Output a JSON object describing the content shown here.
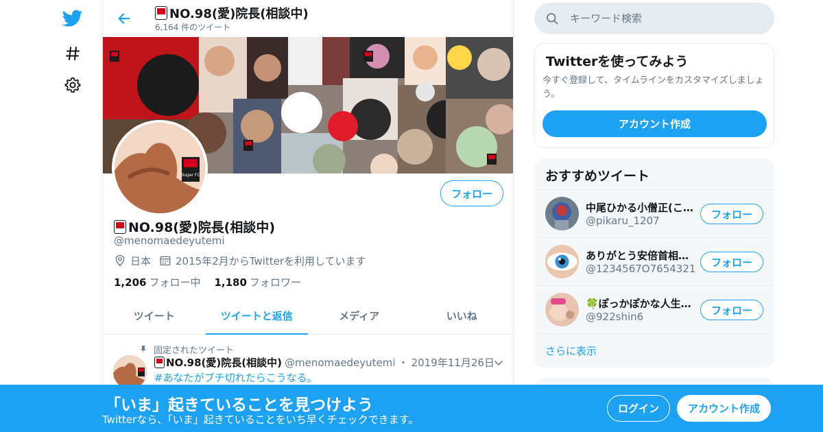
{
  "nav": {
    "items": [
      {
        "icon": "twitter-bird-icon"
      },
      {
        "icon": "hashtag-icon"
      },
      {
        "icon": "gear-icon"
      }
    ]
  },
  "header": {
    "name": "NO.98(愛)院長(相談中)",
    "tweet_count": "6,164 件のツイート"
  },
  "profile": {
    "name": "NO.98(愛)院長(相談中)",
    "handle": "@menomaedeyutemi",
    "location": "日本",
    "joined": "2015年2月からTwitterを利用しています",
    "following_count": "1,206",
    "following_label": "フォロー中",
    "followers_count": "1,180",
    "followers_label": "フォロワー",
    "follow_label": "フォロー",
    "avatar_badge": "Sugar FC"
  },
  "tabs": [
    {
      "label": "ツイート",
      "active": false
    },
    {
      "label": "ツイートと返信",
      "active": true
    },
    {
      "label": "メディア",
      "active": false
    },
    {
      "label": "いいね",
      "active": false
    }
  ],
  "tweet": {
    "pinned_label": "固定されたツイート",
    "author_name": "NO.98(愛)院長(相談中)",
    "author_handle": "@menomaedeyutemi",
    "separator": "・",
    "date": "2019年11月26日",
    "text": "#あなたがブチ切れたらこうなる。"
  },
  "search": {
    "placeholder": "キーワード検索"
  },
  "signup_card": {
    "title": "Twitterを使ってみよう",
    "description": "今すぐ登録して、タイムラインをカスタマイズしましょう。",
    "button_label": "アカウント作成"
  },
  "recommended": {
    "title": "おすすめツイート",
    "follow_label": "フォロー",
    "items": [
      {
        "name": "中尾ひかる小僧正(こ…",
        "handle": "@pikaru_1207"
      },
      {
        "name": "ありがとう安倍首相…",
        "handle": "@1234567O7654321"
      },
      {
        "name": "🍀ぽっかぽかな人生…",
        "handle": "@922shin6"
      }
    ],
    "more_label": "さらに表示"
  },
  "bottom_bar": {
    "title": "「いま」起きていることを見つけよう",
    "subtitle": "Twitterなら、「いま」起きていることをいち早くチェックできます。",
    "login_label": "ログイン",
    "signup_label": "アカウント作成"
  },
  "colors": {
    "brand": "#1da1f2",
    "text": "#14171a",
    "muted": "#657786",
    "border": "#e6ecf0",
    "panel": "#f5f8fa"
  }
}
